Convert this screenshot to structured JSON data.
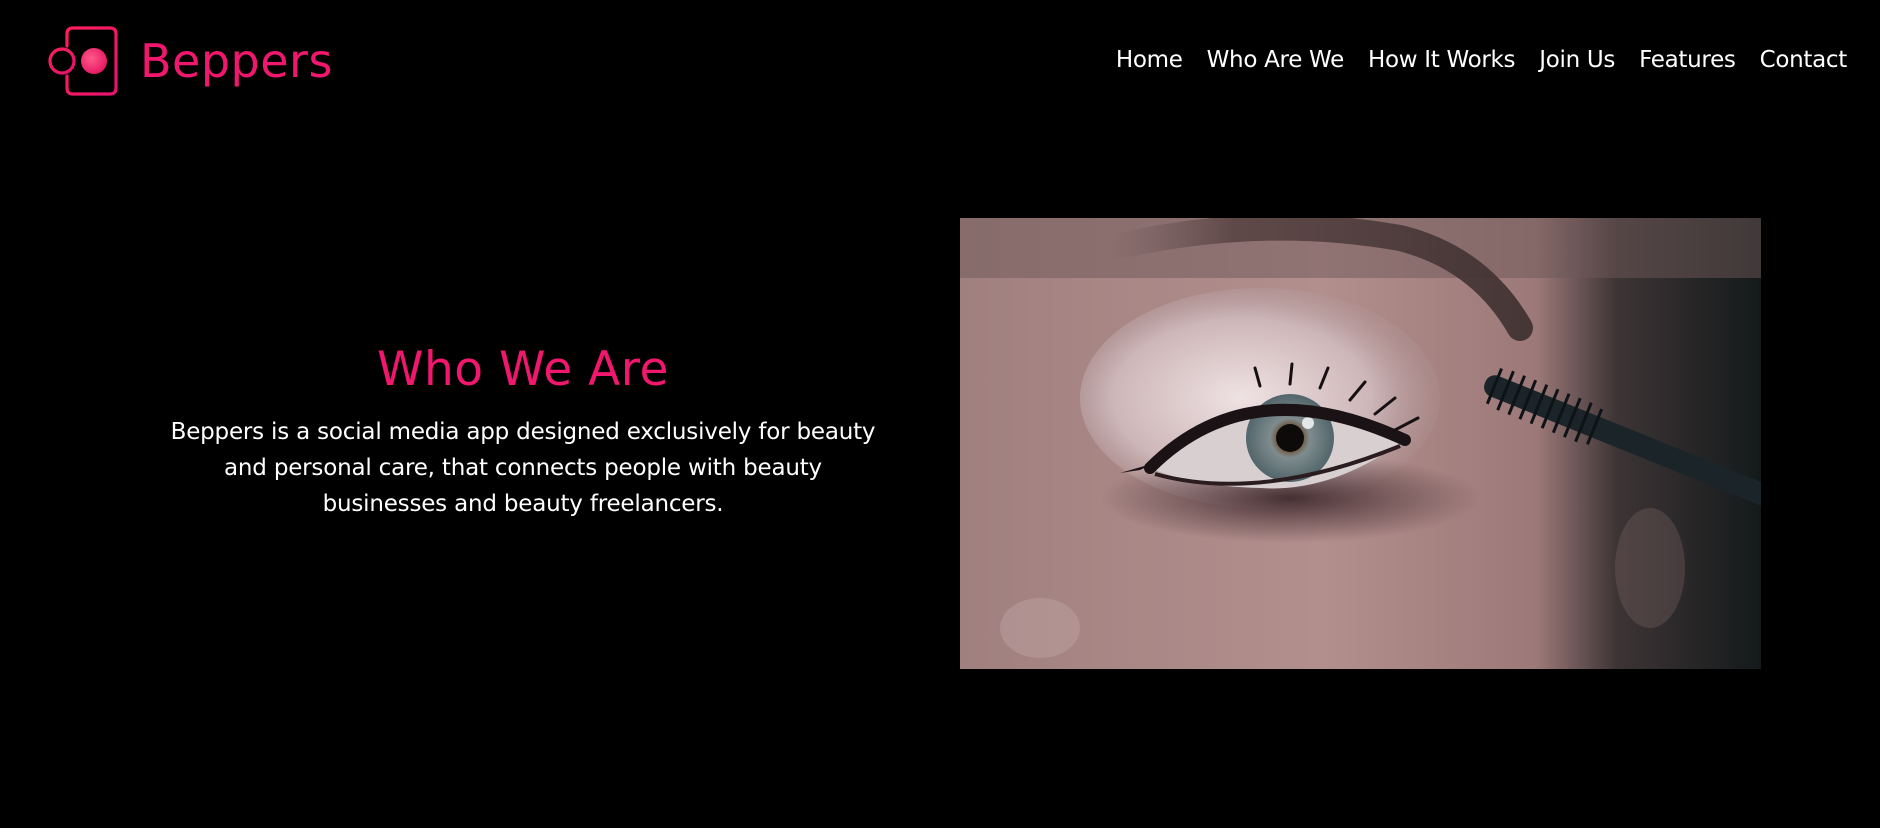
{
  "brand": {
    "name": "Beppers",
    "logo_icon": "beppers-logo-icon",
    "accent_color": "#f2176e"
  },
  "nav": {
    "items": [
      {
        "label": "Home"
      },
      {
        "label": "Who Are We"
      },
      {
        "label": "How It Works"
      },
      {
        "label": "Join Us"
      },
      {
        "label": "Features"
      },
      {
        "label": "Contact"
      }
    ]
  },
  "about": {
    "title": "Who We Are",
    "body": "Beppers is a social media app designed exclusively for beauty and personal care, that connects people with beauty businesses and beauty freelancers.",
    "image": "eye-makeup-mascara-photo"
  },
  "colors": {
    "background": "#000000",
    "text": "#ffffff",
    "accent": "#f2176e"
  }
}
